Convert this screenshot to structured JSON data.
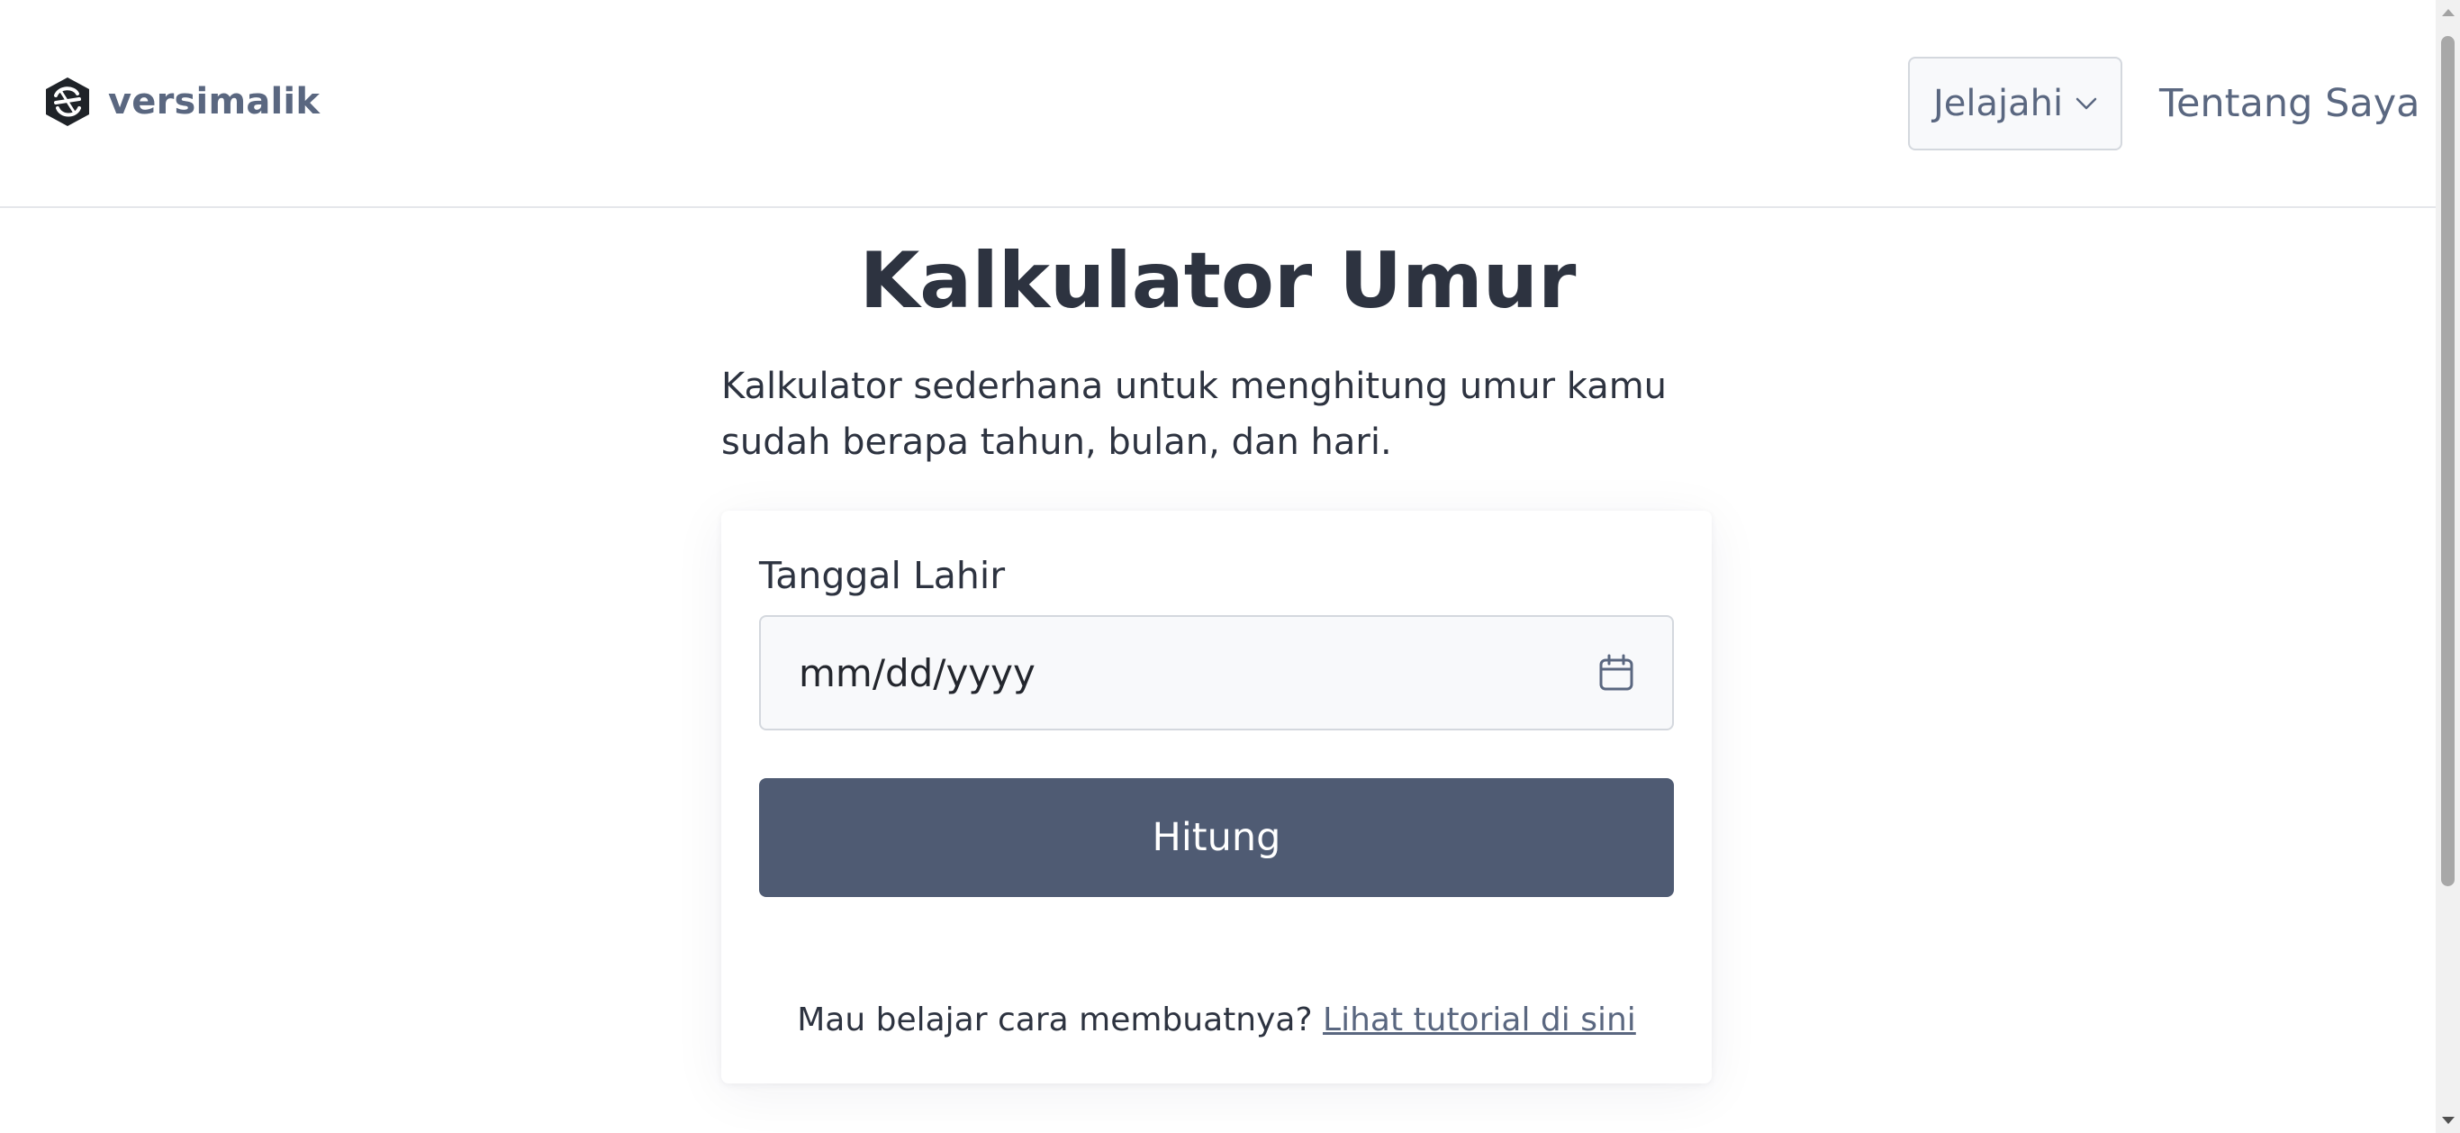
{
  "header": {
    "brand_name": "versimalik",
    "explore_label": "Jelajahi",
    "about_label": "Tentang Saya"
  },
  "main": {
    "title": "Kalkulator Umur",
    "description": "Kalkulator sederhana untuk menghitung umur kamu sudah berapa tahun, bulan, dan hari."
  },
  "form": {
    "birthdate_label": "Tanggal Lahir",
    "birthdate_placeholder": "mm/dd/yyyy",
    "submit_label": "Hitung",
    "tutorial_prompt": "Mau belajar cara membuatnya?",
    "tutorial_link": "Lihat tutorial di sini"
  },
  "icons": {
    "logo": "versimalik-logo",
    "explore_chevron": "chevron-down-icon",
    "date_picker": "calendar-icon"
  },
  "colors": {
    "brand": "#5a6780",
    "button": "#4f5b73",
    "text": "#2d3340"
  }
}
